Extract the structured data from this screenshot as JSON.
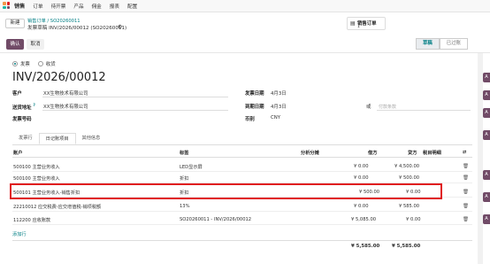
{
  "navbar": {
    "app_name": "销售",
    "menu": [
      "订单",
      "待开票",
      "产品",
      "佣金",
      "报表",
      "配置"
    ]
  },
  "breadcrumb": {
    "new_button": "新建",
    "parent": "销售订单 / SO20260011",
    "current": "发票草稿 INV/2026/00012 (SO20260011)"
  },
  "smart_button": {
    "label": "销售订单",
    "count": "1"
  },
  "actions": {
    "confirm": "确认",
    "cancel": "取消"
  },
  "status": {
    "draft": "草稿",
    "posted": "已过账"
  },
  "form": {
    "type_invoice": "发票",
    "type_receipt": "收货",
    "title": "INV/2026/00012",
    "customer_label": "客户",
    "customer_value": "XX生物技术有限公司",
    "delivery_label": "送货地址",
    "delivery_hint": "?",
    "delivery_value": "XX生物技术有限公司",
    "invoice_no_label": "发票号码",
    "invoice_date_label": "发票日期",
    "invoice_date_value": "4月3日",
    "due_date_label": "到期日期",
    "due_date_value": "4月3日",
    "or_label": "或",
    "payment_terms_placeholder": "付款条款",
    "currency_label": "币别",
    "currency_value": "CNY"
  },
  "tabs": [
    "发票行",
    "日记账项目",
    "其他信息"
  ],
  "table": {
    "headers": {
      "account": "账户",
      "label": "标签",
      "analytic": "分析分摊",
      "debit": "借方",
      "credit": "贷方",
      "tax_grid": "税目明细"
    },
    "rows": [
      {
        "account": "500100 主营业务收入",
        "label": "LED显示屏",
        "debit": "¥ 0.00",
        "credit": "¥ 4,500.00"
      },
      {
        "account": "500100 主营业务收入",
        "label": "折扣",
        "debit": "¥ 0.00",
        "credit": "¥ 500.00"
      },
      {
        "account": "500101 主营业务收入-销售折扣",
        "label": "折扣",
        "debit": "¥ 500.00",
        "credit": "¥ 0.00"
      },
      {
        "account": "22210012 应交税费-应交增值税-销项税额",
        "label": "13%",
        "debit": "¥ 0.00",
        "credit": "¥ 585.00"
      },
      {
        "account": "112200 应收账款",
        "label": "SO20260011 - INV/2026/00012",
        "debit": "¥ 5,085.00",
        "credit": "¥ 0.00"
      }
    ],
    "add_line": "添加行",
    "total_debit": "¥ 5,585.00",
    "total_credit": "¥ 5,585.00"
  },
  "colors": {
    "primary": "#714b67",
    "link": "#017e84",
    "highlight_border": "#e0191e"
  }
}
